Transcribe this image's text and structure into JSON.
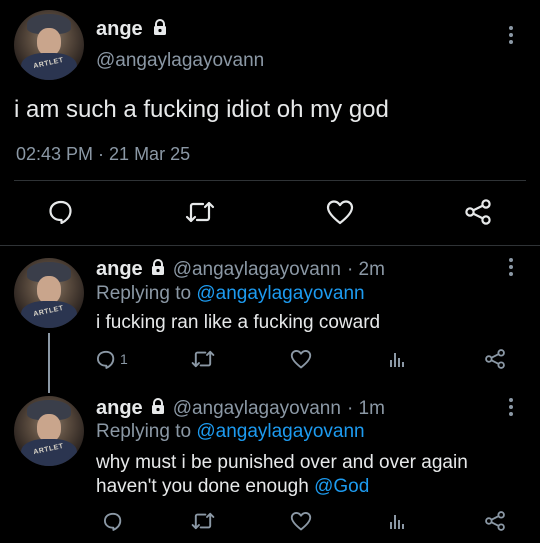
{
  "main_tweet": {
    "name": "ange",
    "handle": "@angaylagayovann",
    "text": "i am such a fucking idiot oh my god",
    "timestamp": "02:43 PM · 21 Mar 25",
    "avatar_text": "ARTLET",
    "actions": [
      "reply-icon",
      "retweet-icon",
      "like-icon",
      "share-icon"
    ]
  },
  "replies": [
    {
      "name": "ange",
      "handle": "@angaylagayovann",
      "time": "· 2m",
      "replying_prefix": "Replying to",
      "replying_handle": "@angaylagayovann",
      "text_line1": "i fucking ran like a fucking coward",
      "reply_count": "1",
      "avatar_text": "ARTLET"
    },
    {
      "name": "ange",
      "handle": "@angaylagayovann",
      "time": "· 1m",
      "replying_prefix": "Replying to",
      "replying_handle": "@angaylagayovann",
      "text_line1": "why must i be punished over and over again",
      "text_line2_prefix": "haven't you done enough",
      "text_line2_mention": "@God",
      "avatar_text": "ARTLET"
    }
  ],
  "colors": {
    "background": "#000000",
    "text": "#e7e9ea",
    "secondary": "#8b98a5",
    "link": "#1d9bf0",
    "divider": "#2f3336"
  }
}
